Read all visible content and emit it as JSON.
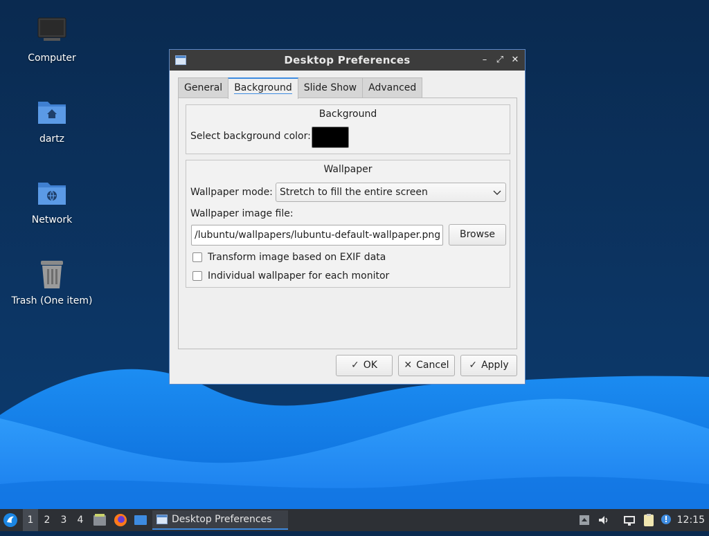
{
  "desktop": {
    "icons": [
      {
        "label": "Computer",
        "icon": "computer-icon"
      },
      {
        "label": "dartz",
        "icon": "home-folder-icon"
      },
      {
        "label": "Network",
        "icon": "network-folder-icon"
      },
      {
        "label": "Trash (One item)",
        "icon": "trash-icon"
      }
    ]
  },
  "dialog": {
    "title": "Desktop Preferences",
    "tabs": [
      {
        "label": "General"
      },
      {
        "label": "Background"
      },
      {
        "label": "Slide Show"
      },
      {
        "label": "Advanced"
      }
    ],
    "active_tab": "Background",
    "background_group": {
      "title": "Background",
      "color_label": "Select background color:",
      "color_value": "#000000"
    },
    "wallpaper_group": {
      "title": "Wallpaper",
      "mode_label": "Wallpaper mode:",
      "mode_value": "Stretch to fill the entire screen",
      "file_label": "Wallpaper image file:",
      "file_value": "/lubuntu/wallpapers/lubuntu-default-wallpaper.png",
      "browse_label": "Browse",
      "exif_label": "Transform image based on EXIF data",
      "exif_checked": false,
      "per_monitor_label": "Individual wallpaper for each monitor",
      "per_monitor_checked": false
    },
    "buttons": {
      "ok": "OK",
      "cancel": "Cancel",
      "apply": "Apply"
    }
  },
  "taskbar": {
    "workspaces": [
      "1",
      "2",
      "3",
      "4"
    ],
    "active_workspace": "1",
    "task_title": "Desktop Preferences",
    "clock": "12:15"
  },
  "colors": {
    "desktop_dark": "#0a2a50",
    "wave_light": "#1a8cff",
    "accent": "#3d8be0",
    "taskbar": "#2d3035"
  }
}
